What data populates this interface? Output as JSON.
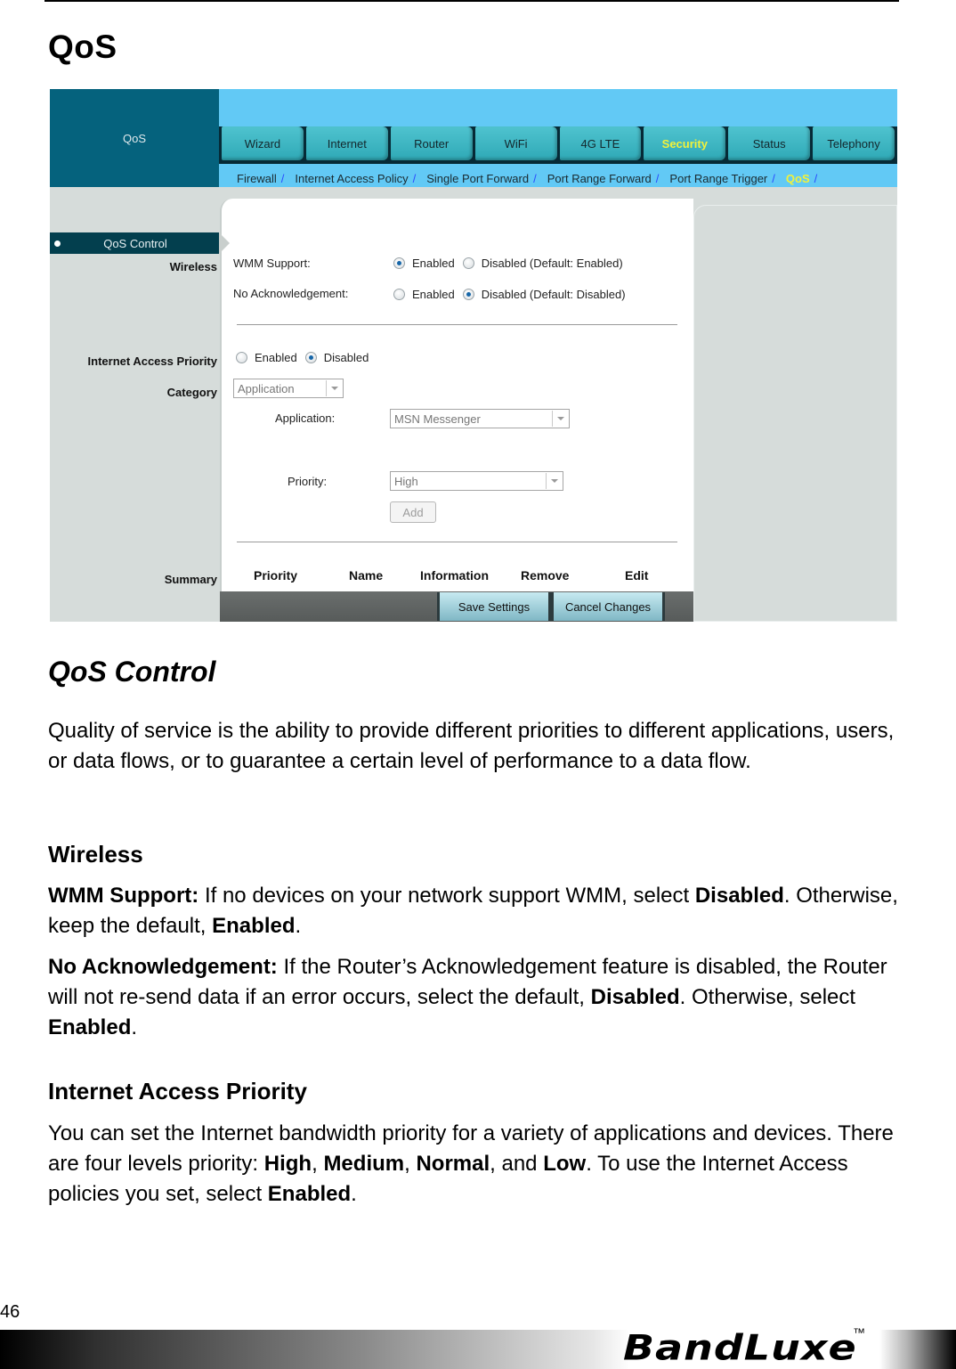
{
  "page": {
    "title": "QoS",
    "page_number": "46"
  },
  "screenshot": {
    "brand_label": "QoS",
    "tabs": [
      {
        "label": "Wizard",
        "active": false
      },
      {
        "label": "Internet",
        "active": false
      },
      {
        "label": "Router",
        "active": false
      },
      {
        "label": "WiFi",
        "active": false
      },
      {
        "label": "4G LTE",
        "active": false
      },
      {
        "label": "Security",
        "active": true
      },
      {
        "label": "Status",
        "active": false
      },
      {
        "label": "Telephony",
        "active": false
      }
    ],
    "subnav": [
      {
        "label": "Firewall",
        "active": false
      },
      {
        "label": "Internet Access Policy",
        "active": false
      },
      {
        "label": "Single Port Forward",
        "active": false
      },
      {
        "label": "Port Range Forward",
        "active": false
      },
      {
        "label": "Port Range Trigger",
        "active": false
      },
      {
        "label": "QoS",
        "active": true
      }
    ],
    "subnav_separator": "/",
    "menu_active": "QoS Control",
    "section_labels": {
      "wireless": "Wireless",
      "internet_access_priority": "Internet Access Priority",
      "category": "Category",
      "summary": "Summary"
    },
    "wmm_support": {
      "label": "WMM Support:",
      "options": [
        "Enabled",
        "Disabled (Default: Enabled)"
      ],
      "selected": "Enabled"
    },
    "no_acknowledgement": {
      "label": "No Acknowledgement:",
      "options": [
        "Enabled",
        "Disabled (Default: Disabled)"
      ],
      "selected": "Disabled (Default: Disabled)"
    },
    "internet_access_priority": {
      "options": [
        "Enabled",
        "Disabled"
      ],
      "selected": "Disabled"
    },
    "category_select": "Application",
    "application": {
      "label": "Application:",
      "value": "MSN Messenger"
    },
    "priority": {
      "label": "Priority:",
      "value": "High"
    },
    "add_button": "Add",
    "summary_columns": [
      "Priority",
      "Name",
      "Information",
      "Remove",
      "Edit"
    ],
    "save_button": "Save Settings",
    "cancel_button": "Cancel Changes"
  },
  "doc": {
    "section_title": "QoS Control",
    "intro": "Quality of service is the ability to provide different priorities to different applications, users, or data flows, or to guarantee a certain level of performance to a data flow.",
    "wireless_heading": "Wireless",
    "wmm": {
      "term": "WMM Support:",
      "t1": " If no devices on your network support WMM, select ",
      "b1": "Disabled",
      "t2": ". Otherwise, keep the default, ",
      "b2": "Enabled",
      "t3": "."
    },
    "noack": {
      "term": "No Acknowledgement:",
      "t1": " If the Router’s Acknowledgement feature is disabled, the Router will not re-send data if an error occurs, select the default, ",
      "b1": "Disabled",
      "t2": ". Otherwise, select ",
      "b2": "Enabled",
      "t3": "."
    },
    "iap_heading": "Internet Access Priority",
    "iap": {
      "t1": "You can set the Internet bandwidth priority for a variety of applications and devices. There are four levels priority: ",
      "b1": "High",
      "t2": ", ",
      "b2": "Medium",
      "t3": ", ",
      "b3": "Normal",
      "t4": ", and ",
      "b4": "Low",
      "t5": ". To use the Internet Access policies you set, select ",
      "b5": "Enabled",
      "t6": "."
    }
  },
  "footer": {
    "brand": "BandLuxe",
    "trademark": "™"
  }
}
